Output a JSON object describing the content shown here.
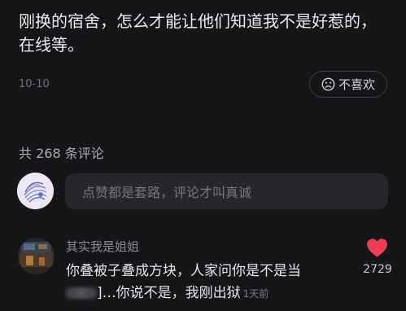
{
  "post": {
    "text": "刚换的宿舍，怎么才能让他们知道我不是好惹的，在线等。",
    "date": "10-10",
    "dislike_label": "不喜欢"
  },
  "comments_header": "共 268 条评论",
  "comment_input": {
    "placeholder": "点赞都是套路，评论才叫真诚"
  },
  "comment": {
    "username": "其实我是姐姐",
    "text_part1": "你叠被子叠成方块，人家问你是不是当",
    "text_part2": "]…你说不是，我刚出狱",
    "time": "1天前",
    "likes": "2729"
  },
  "colors": {
    "background": "#151618",
    "like_heart": "#ee3e55",
    "input_bg": "#26272b"
  },
  "icons": {
    "dislike": "frown-face-icon",
    "like": "heart-icon"
  }
}
